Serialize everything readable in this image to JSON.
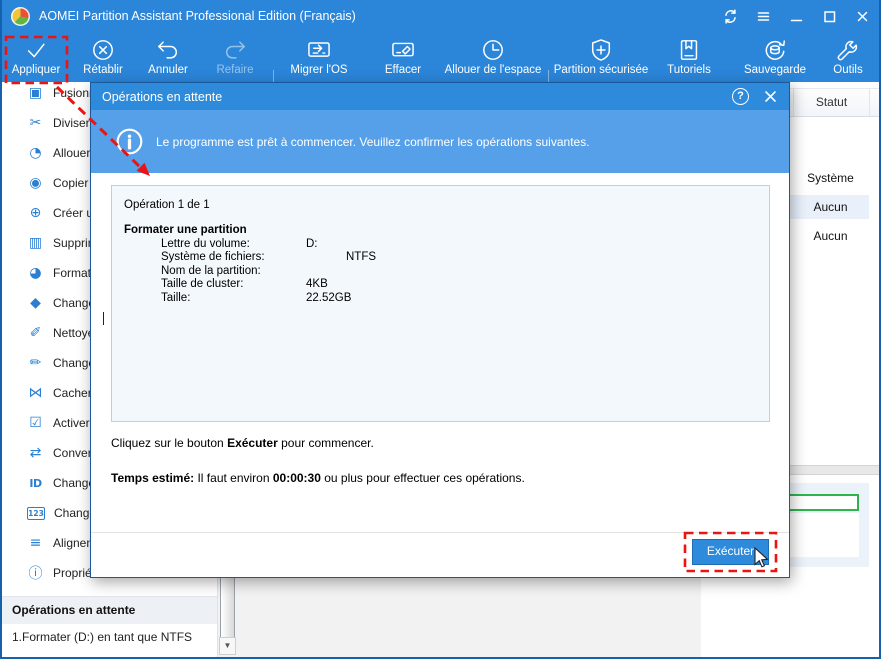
{
  "window": {
    "title": "AOMEI Partition Assistant Professional Edition (Français)"
  },
  "toolbar": {
    "items": [
      {
        "label": "Appliquer"
      },
      {
        "label": "Rétablir"
      },
      {
        "label": "Annuler"
      },
      {
        "label": "Refaire"
      },
      {
        "label": "Migrer l'OS"
      },
      {
        "label": "Effacer"
      },
      {
        "label": "Allouer de l'espace"
      },
      {
        "label": "Partition sécurisée"
      },
      {
        "label": "Tutoriels"
      },
      {
        "label": "Sauvegarde"
      },
      {
        "label": "Outils"
      }
    ]
  },
  "sidebar": {
    "items": [
      {
        "glyph": "▣",
        "label": "Fusionn"
      },
      {
        "glyph": "✂",
        "label": "Diviser u"
      },
      {
        "glyph": "◔",
        "label": "Allouer d"
      },
      {
        "glyph": "◉",
        "label": "Copier u"
      },
      {
        "glyph": "⊕",
        "label": "Créer un"
      },
      {
        "glyph": "▥",
        "label": "Supprime"
      },
      {
        "glyph": "◕",
        "label": "Formate"
      },
      {
        "glyph": "◆",
        "label": "Changer"
      },
      {
        "glyph": "✐",
        "label": "Nettoyer"
      },
      {
        "glyph": "✏",
        "label": "Changer"
      },
      {
        "glyph": "⋈",
        "label": "Cacher u"
      },
      {
        "glyph": "☑",
        "label": "Activer u"
      },
      {
        "glyph": "⇄",
        "label": "Converti"
      },
      {
        "glyph": "ID",
        "label": "Changer"
      },
      {
        "glyph": "123",
        "label": "Changer"
      },
      {
        "glyph": "≡",
        "label": "Aligneme"
      },
      {
        "glyph": "ⓘ",
        "label": "Propriété"
      }
    ],
    "pending_panel": {
      "header": "Opérations en attente",
      "item": "1.Formater (D:) en tant que NTFS"
    }
  },
  "table": {
    "status_header": "Statut",
    "rows": [
      "Système",
      "Aucun",
      "Aucun"
    ]
  },
  "dialog": {
    "title": "Opérations en attente",
    "help_glyph": "?",
    "info_message": "Le programme est prêt à commencer. Veuillez confirmer les opérations suivantes.",
    "operation_counter": "Opération 1 de 1",
    "operation_title": "Formater une partition",
    "details": [
      {
        "label": "Lettre du volume:",
        "value": "D:"
      },
      {
        "label": "Système de fichiers:",
        "value": "NTFS"
      },
      {
        "label": "Nom de la partition:",
        "value": ""
      },
      {
        "label": "Taille de cluster:",
        "value": "4KB"
      },
      {
        "label": "Taille:",
        "value": "22.52GB"
      }
    ],
    "instruction": {
      "prefix": "Cliquez sur le bouton ",
      "bold": "Exécuter",
      "suffix": " pour commencer."
    },
    "estimate": {
      "bold": "Temps estimé:",
      "mid": " Il faut environ ",
      "time": "00:00:30",
      "suffix": " ou plus pour effectuer ces opérations."
    },
    "execute_label": "Exécuter"
  },
  "colors": {
    "titlebar_blue": "#2b85d8",
    "dialog_header_blue": "#2e8ada",
    "info_bar_blue": "#55a0e8",
    "annotation_red": "#ec1313",
    "sidebar_icon_blue": "#2a7fd4",
    "partition_green": "#2eb34f"
  }
}
